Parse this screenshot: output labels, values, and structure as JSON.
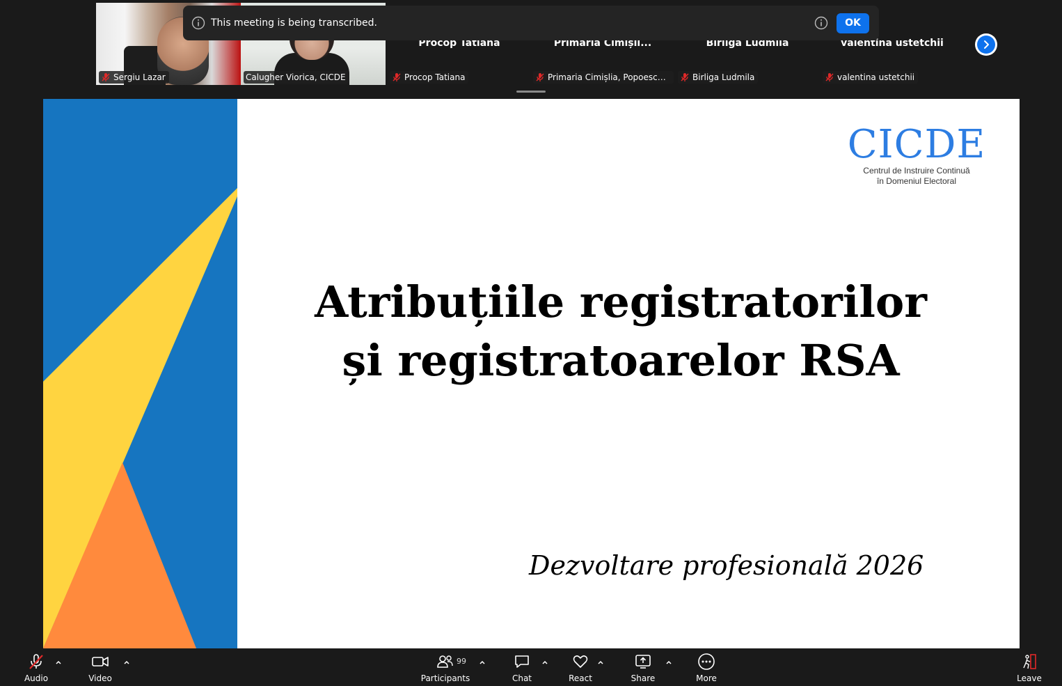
{
  "banner": {
    "message": "This meeting is being transcribed.",
    "ok_label": "OK"
  },
  "participants": [
    {
      "name": "Sergiu Lazar",
      "muted": true,
      "video": true
    },
    {
      "name": "Calugher Viorica, CICDE",
      "muted": false,
      "video": true,
      "active": true
    },
    {
      "name": "Procop Tatiana",
      "display_name": "Procop Tatiana",
      "muted": true,
      "video": false
    },
    {
      "name": "Primaria Cimișlia, Popoescu D...",
      "display_name": "Primaria  Cimișli...",
      "muted": true,
      "video": false
    },
    {
      "name": "Birliga Ludmila",
      "display_name": "Birliga Ludmila",
      "muted": true,
      "video": false
    },
    {
      "name": "valentina ustetchii",
      "display_name": "valentina ustetchii",
      "muted": true,
      "video": false
    }
  ],
  "slide": {
    "logo_mark": "CICDE",
    "logo_line1": "Centrul de Instruire Continuă",
    "logo_line2": "în Domeniul Electoral",
    "title_line1": "Atribuțiile registratorilor",
    "title_line2": "și registratoarelor RSA",
    "subtitle": "Dezvoltare profesională 2026",
    "colors": {
      "blue": "#1675c0",
      "yellow": "#ffd440",
      "orange": "#ff8a3d",
      "logo": "#2d7de2"
    }
  },
  "toolbar": {
    "audio": "Audio",
    "video": "Video",
    "participants": "Participants",
    "participants_count": "99",
    "chat": "Chat",
    "react": "React",
    "share": "Share",
    "more": "More",
    "leave": "Leave"
  },
  "icons": [
    "info-icon",
    "muted-mic-icon",
    "chevron-right-icon",
    "mic-muted-icon",
    "video-camera-icon",
    "participants-icon",
    "chat-icon",
    "heart-icon",
    "share-screen-icon",
    "more-icon",
    "leave-icon",
    "caret-up-icon"
  ]
}
